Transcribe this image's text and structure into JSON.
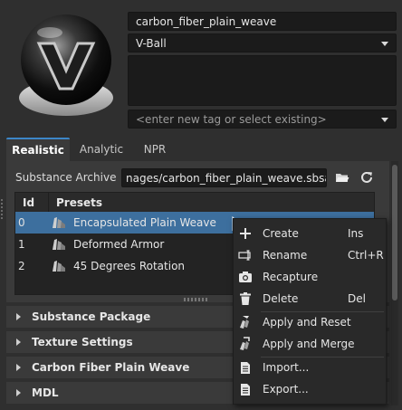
{
  "material": {
    "name": "carbon_fiber_plain_weave",
    "preview_shape": "V-Ball",
    "tag_placeholder": "<enter new tag or select existing>"
  },
  "tabs": [
    {
      "label": "Realistic",
      "active": true
    },
    {
      "label": "Analytic",
      "active": false
    },
    {
      "label": "NPR",
      "active": false
    }
  ],
  "substance": {
    "archive_label": "Substance Archive",
    "archive_path": "nages/carbon_fiber_plain_weave.sbsar"
  },
  "presets_table": {
    "headers": [
      "Id",
      "Presets"
    ],
    "rows": [
      {
        "id": "0",
        "name": "Encapsulated Plain Weave",
        "selected": true
      },
      {
        "id": "1",
        "name": "Deformed Armor",
        "selected": false
      },
      {
        "id": "2",
        "name": "45 Degrees Rotation",
        "selected": false
      }
    ]
  },
  "sections": [
    {
      "label": "Substance Package"
    },
    {
      "label": "Texture Settings"
    },
    {
      "label": "Carbon Fiber Plain Weave"
    },
    {
      "label": "MDL"
    }
  ],
  "context_menu": {
    "items": [
      {
        "label": "Create",
        "shortcut": "Ins",
        "icon": "plus-icon"
      },
      {
        "label": "Rename",
        "shortcut": "Ctrl+R",
        "icon": "rename-icon"
      },
      {
        "label": "Recapture",
        "shortcut": "",
        "icon": "camera-icon"
      },
      {
        "label": "Delete",
        "shortcut": "Del",
        "icon": "trash-icon"
      },
      {
        "label": "Apply and Reset",
        "shortcut": "",
        "icon": "apply-reset-icon"
      },
      {
        "label": "Apply and Merge",
        "shortcut": "",
        "icon": "apply-merge-icon"
      },
      {
        "label": "Import...",
        "shortcut": "",
        "icon": "import-icon"
      },
      {
        "label": "Export...",
        "shortcut": "",
        "icon": "export-icon"
      }
    ]
  },
  "colors": {
    "background": "#2f2f2f",
    "panel": "#3a3a3a",
    "field": "#1b1b1b",
    "selection": "#3d6f9e",
    "accent": "#3c86c8"
  }
}
